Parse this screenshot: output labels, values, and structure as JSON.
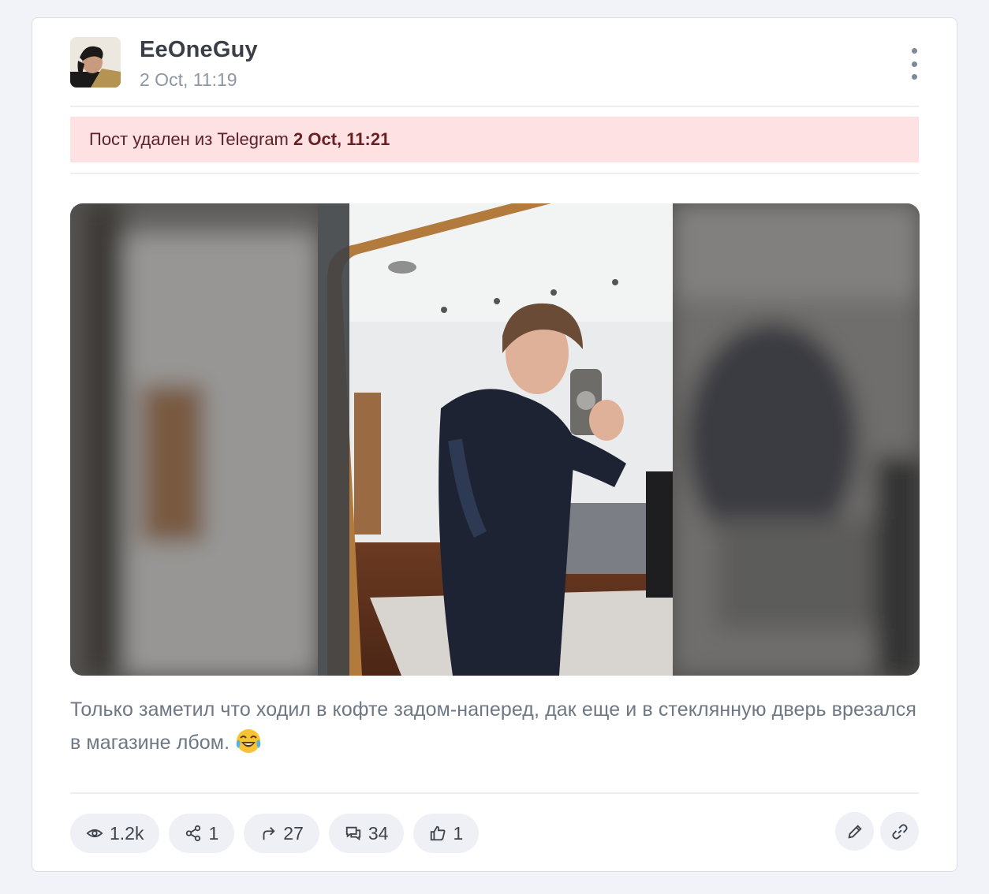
{
  "post": {
    "author": "EeOneGuy",
    "datetime": "2 Oct, 11:19",
    "deleted_notice": {
      "prefix": "Пост удален из Telegram",
      "date": "2 Oct, 11:21"
    },
    "caption": "Только заметил что ходил в кофте задом-наперед, дак еще и в стеклянную дверь врезался в магазине лбом.",
    "caption_emoji": "face-with-tears-of-joy",
    "media_description_icon": "selfie-photo"
  },
  "stats": {
    "views": "1.2k",
    "shares": "1",
    "forwards": "27",
    "comments": "34",
    "reactions": "1"
  },
  "icons": {
    "views": "eye-icon",
    "shares": "share-icon",
    "forwards": "forward-arrow-icon",
    "comments": "comments-icon",
    "reactions": "thumbs-up-icon",
    "edit": "pencil-icon",
    "link": "link-icon",
    "menu": "more-vertical-icon"
  },
  "colors": {
    "deleted_bg": "#fde1e3",
    "pill_bg": "#eef0f5",
    "card_bg": "#ffffff",
    "page_bg": "#f1f3f8"
  }
}
